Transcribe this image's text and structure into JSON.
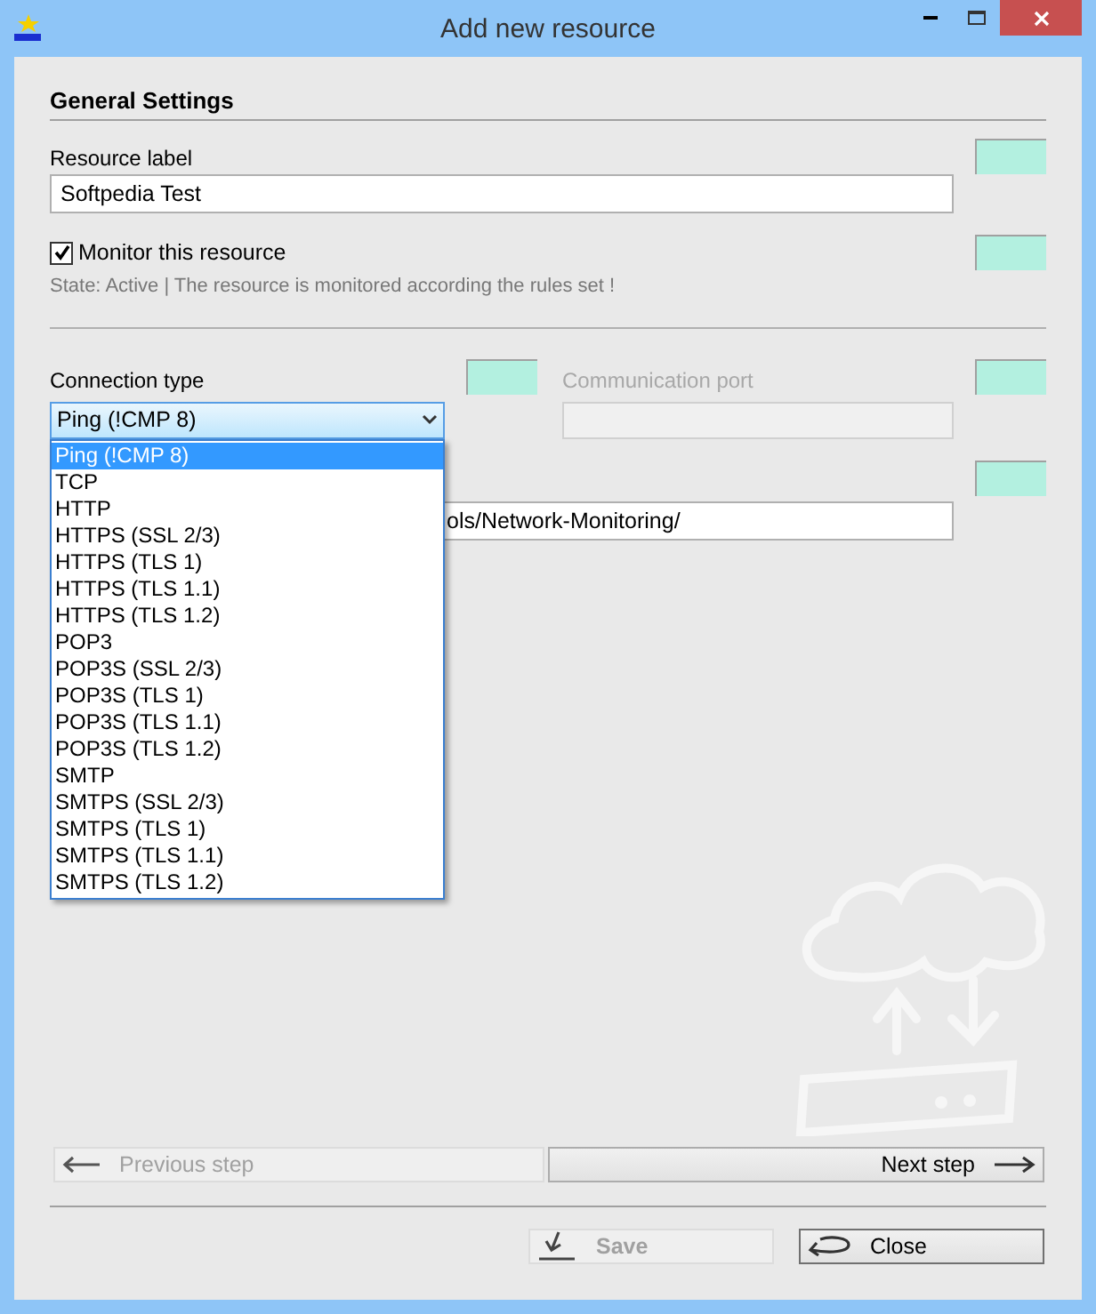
{
  "window": {
    "title": "Add new resource"
  },
  "section": {
    "title": "General Settings"
  },
  "resource_label": {
    "label": "Resource label",
    "value": "Softpedia Test"
  },
  "monitor": {
    "label": "Monitor this resource",
    "checked": true,
    "state_text": "State: Active | The resource is monitored according the rules set !"
  },
  "connection_type": {
    "label": "Connection type",
    "value": "Ping (!CMP 8)",
    "expanded": true,
    "options": [
      {
        "label": "Ping (!CMP 8)",
        "selected": true
      },
      {
        "label": "TCP",
        "selected": false
      },
      {
        "label": "HTTP",
        "selected": false
      },
      {
        "label": "HTTPS (SSL 2/3)",
        "selected": false
      },
      {
        "label": "HTTPS (TLS 1)",
        "selected": false
      },
      {
        "label": "HTTPS (TLS 1.1)",
        "selected": false
      },
      {
        "label": "HTTPS (TLS 1.2)",
        "selected": false
      },
      {
        "label": "POP3",
        "selected": false
      },
      {
        "label": "POP3S (SSL 2/3)",
        "selected": false
      },
      {
        "label": "POP3S (TLS 1)",
        "selected": false
      },
      {
        "label": "POP3S (TLS 1.1)",
        "selected": false
      },
      {
        "label": "POP3S (TLS 1.2)",
        "selected": false
      },
      {
        "label": "SMTP",
        "selected": false
      },
      {
        "label": "SMTPS (SSL 2/3)",
        "selected": false
      },
      {
        "label": "SMTPS (TLS 1)",
        "selected": false
      },
      {
        "label": "SMTPS (TLS 1.1)",
        "selected": false
      },
      {
        "label": "SMTPS (TLS 1.2)",
        "selected": false
      }
    ]
  },
  "communication_port": {
    "label": "Communication port",
    "disabled": true
  },
  "address": {
    "value": "ols/Network-Monitoring/"
  },
  "nav": [
    {
      "label": "Previous step",
      "kind": "previous",
      "disabled": true
    },
    {
      "label": "Next step",
      "kind": "next",
      "disabled": false
    }
  ],
  "buttons": [
    {
      "label": "Save",
      "kind": "save",
      "disabled": true
    },
    {
      "label": "Close",
      "kind": "close",
      "disabled": false
    }
  ]
}
